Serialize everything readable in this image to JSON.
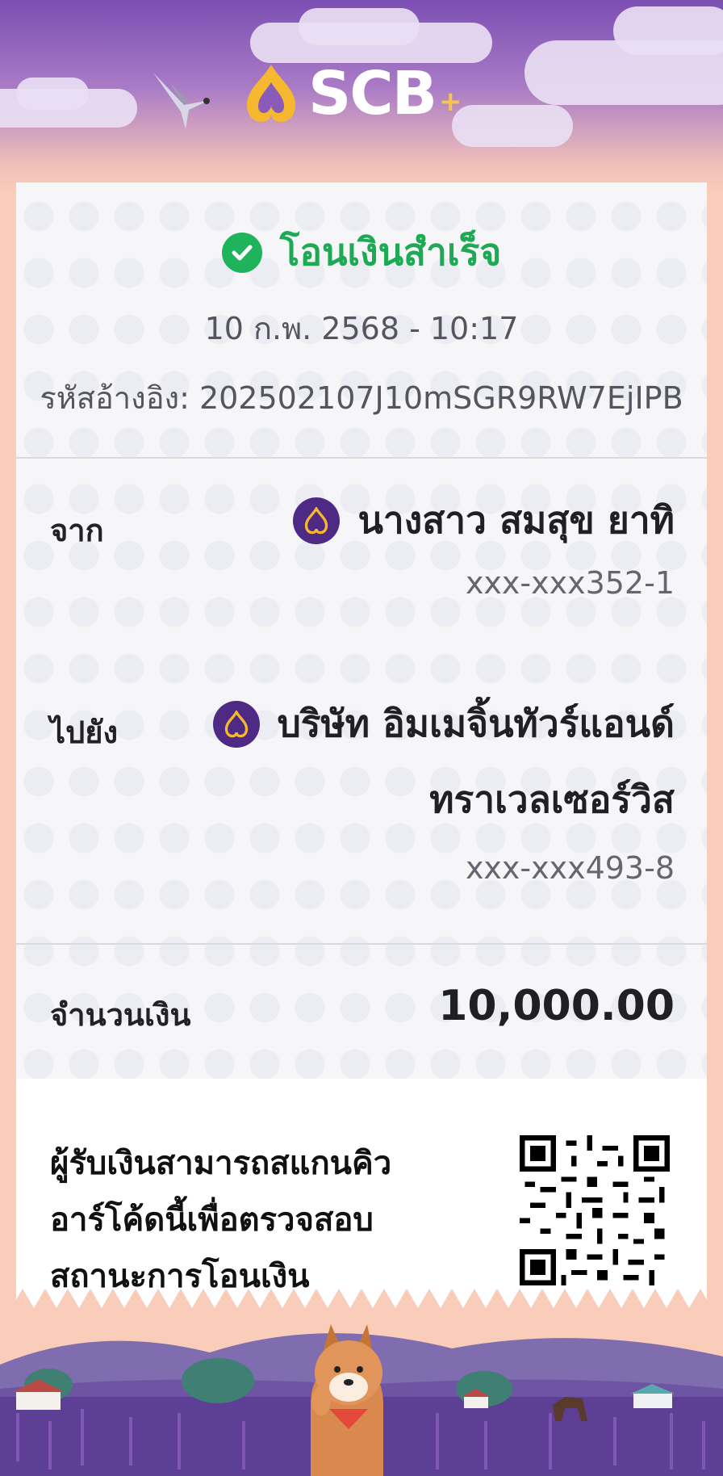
{
  "header": {
    "logo_text": "SCB",
    "logo_plus": "+",
    "brand_color": "#4e2a84",
    "accent_gold": "#f5b82e"
  },
  "status": {
    "text": "โอนเงินสำเร็จ",
    "icon": "check-circle-icon",
    "color": "#1ea955"
  },
  "transaction": {
    "datetime": "10 ก.พ. 2568 - 10:17",
    "reference": "รหัสอ้างอิง: 202502107J10mSGR9RW7EjIPB"
  },
  "from": {
    "label": "จาก",
    "name": "นางสาว สมสุข ยาทิ",
    "account": "xxx-xxx352-1",
    "bank_icon": "scb-bank-icon"
  },
  "to": {
    "label": "ไปยัง",
    "name_line1": "บริษัท อิมเมจิ้นทัวร์แอนด์",
    "name_line2": "ทราเวลเซอร์วิส",
    "account": "xxx-xxx493-8",
    "bank_icon": "scb-bank-icon"
  },
  "amount": {
    "label": "จำนวนเงิน",
    "value": "10,000.00"
  },
  "qr_section": {
    "line1": "ผู้รับเงินสามารถสแกนคิว",
    "line2": "อาร์โค้ดนี้เพื่อตรวจสอบ",
    "line3": "สถานะการโอนเงิน",
    "icon": "qr-code-icon"
  }
}
